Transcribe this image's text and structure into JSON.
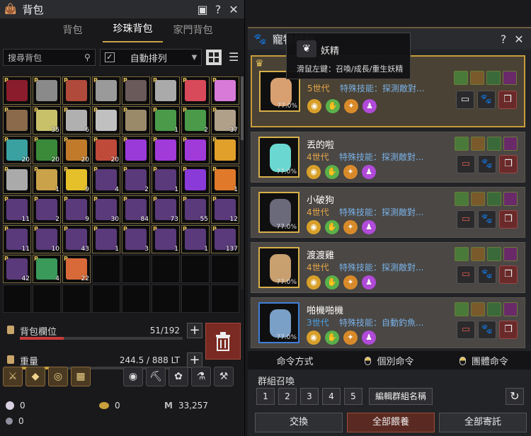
{
  "bag": {
    "title": "背包",
    "tabs": [
      "背包",
      "珍珠背包",
      "家門背包"
    ],
    "search_placeholder": "搜尋背包",
    "autosort_label": "自動排列",
    "autosort_checked": "✓",
    "slots_label": "背包欄位",
    "slots_value": "51/192",
    "slots_fill": 0.27,
    "weight_label": "重量",
    "weight_value": "244.5 / 888 LT",
    "weight_fill": 0.28,
    "items": [
      {
        "color": "#8a1c2c",
        "count": "",
        "p": "P"
      },
      {
        "color": "#8a8a8a",
        "count": "",
        "p": "P"
      },
      {
        "color": "#b04a3a",
        "count": "",
        "p": "P"
      },
      {
        "color": "#9a9a9a",
        "count": "",
        "p": "P"
      },
      {
        "color": "#6a5a5a",
        "count": "",
        "p": "P"
      },
      {
        "color": "#aaaaaa",
        "count": "",
        "p": "P"
      },
      {
        "color": "#d84a5a",
        "count": "",
        "p": "P"
      },
      {
        "color": "#d87ad8",
        "count": "",
        "p": "P"
      },
      {
        "color": "#8a6a4a",
        "count": "",
        "p": "P"
      },
      {
        "color": "#c9c06a",
        "count": "35",
        "p": "P"
      },
      {
        "color": "#b0b0b0",
        "count": "6",
        "p": "P"
      },
      {
        "color": "#c0c0c0",
        "count": "",
        "p": "P"
      },
      {
        "color": "#9a8a6a",
        "count": "",
        "p": "P"
      },
      {
        "color": "#4a9a4a",
        "count": "1",
        "p": "P"
      },
      {
        "color": "#4a9a4a",
        "count": "2",
        "p": "P"
      },
      {
        "color": "#b0a08a",
        "count": "37",
        "p": "P"
      },
      {
        "color": "#3aa0a0",
        "count": "20",
        "p": "P"
      },
      {
        "color": "#3a8a3a",
        "count": "20",
        "p": "P"
      },
      {
        "color": "#c07a2a",
        "count": "20",
        "p": "P"
      },
      {
        "color": "#c04a3a",
        "count": "20",
        "p": "P"
      },
      {
        "color": "#9a3ad8",
        "count": "",
        "p": "P"
      },
      {
        "color": "#a03ad8",
        "count": "",
        "p": "P"
      },
      {
        "color": "#a03ad8",
        "count": "",
        "p": "P"
      },
      {
        "color": "#e0a02a",
        "count": "",
        "p": "P"
      },
      {
        "color": "#aaaaaa",
        "count": "",
        "p": "P"
      },
      {
        "color": "#c9a24a",
        "count": "1",
        "p": "P"
      },
      {
        "color": "#e6c02a",
        "count": "9",
        "p": "P"
      },
      {
        "color": "#5a3a7a",
        "count": "4",
        "p": "P"
      },
      {
        "color": "#5a3a7a",
        "count": "2",
        "p": "P"
      },
      {
        "color": "#5a3a7a",
        "count": "1",
        "p": "P"
      },
      {
        "color": "#8a3ad8",
        "count": "",
        "p": "P"
      },
      {
        "color": "#e07a2a",
        "count": "1",
        "p": "P"
      },
      {
        "color": "#5a3a7a",
        "count": "11",
        "p": "P"
      },
      {
        "color": "#5a3a7a",
        "count": "2",
        "p": "P"
      },
      {
        "color": "#5a3a7a",
        "count": "9",
        "p": "P"
      },
      {
        "color": "#5a3a7a",
        "count": "30",
        "p": "P"
      },
      {
        "color": "#5a3a7a",
        "count": "84",
        "p": "P"
      },
      {
        "color": "#5a3a7a",
        "count": "73",
        "p": "P"
      },
      {
        "color": "#5a3a7a",
        "count": "55",
        "p": "P"
      },
      {
        "color": "#5a3a7a",
        "count": "12",
        "p": "P"
      },
      {
        "color": "#5a3a7a",
        "count": "11",
        "p": "P"
      },
      {
        "color": "#5a3a7a",
        "count": "10",
        "p": "P"
      },
      {
        "color": "#5a3a7a",
        "count": "43",
        "p": "P"
      },
      {
        "color": "#5a3a7a",
        "count": "1",
        "p": "P"
      },
      {
        "color": "#5a3a7a",
        "count": "3",
        "p": "P"
      },
      {
        "color": "#5a3a7a",
        "count": "1",
        "p": "P"
      },
      {
        "color": "#5a3a7a",
        "count": "1",
        "p": "P"
      },
      {
        "color": "#5a3a7a",
        "count": "137",
        "p": "P"
      },
      {
        "color": "#5a3a7a",
        "count": "42",
        "p": "P"
      },
      {
        "color": "#3a9a5a",
        "count": "4",
        "p": "P"
      },
      {
        "color": "#d86a3a",
        "count": "22",
        "p": "P"
      },
      null,
      null,
      null,
      null,
      null,
      null,
      null,
      null,
      null,
      null,
      null,
      null,
      null
    ],
    "tools": [
      {
        "name": "sword-icon",
        "glyph": "⚔",
        "gold": true
      },
      {
        "name": "gem-icon",
        "glyph": "◆",
        "gold": true
      },
      {
        "name": "ring-icon",
        "glyph": "◎",
        "gold": true
      },
      {
        "name": "grid-icon",
        "glyph": "▦",
        "gold": true
      },
      {
        "name": "lantern-icon",
        "glyph": "◉",
        "gold": false
      },
      {
        "name": "axe-icon",
        "glyph": "⛏",
        "gold": false
      },
      {
        "name": "triskele-icon",
        "glyph": "✿",
        "gold": false
      },
      {
        "name": "potion-icon",
        "glyph": "⚗",
        "gold": false
      },
      {
        "name": "hammer-icon",
        "glyph": "⚒",
        "gold": false
      }
    ],
    "currency": {
      "pearl": "0",
      "silver": "0",
      "coin": "0",
      "mileage": "33,257"
    }
  },
  "pets": {
    "title": "寵物目錄",
    "tooltip": {
      "name": "妖精",
      "hint": "滑鼠左鍵：召喚/成長/重生妖精"
    },
    "list": [
      {
        "name": "",
        "gen": "5世代",
        "skill": "特殊技能：探測敵對...",
        "pct": "77.0%",
        "body": "#d8a070",
        "sel": true,
        "blue": false
      },
      {
        "name": "丟的啦",
        "gen": "4世代",
        "skill": "特殊技能：探測敵對...",
        "pct": "77.0%",
        "body": "#6ad8d0",
        "sel": false,
        "blue": false
      },
      {
        "name": "小破狗",
        "gen": "4世代",
        "skill": "特殊技能：探測敵對...",
        "pct": "77.0%",
        "body": "#6a6a7a",
        "sel": false,
        "blue": false
      },
      {
        "name": "渡渡雞",
        "gen": "4世代",
        "skill": "特殊技能：探測敵對...",
        "pct": "77.0%",
        "body": "#c8a070",
        "sel": false,
        "blue": false
      },
      {
        "name": "啪機啪機",
        "gen": "3世代",
        "skill": "特殊技能：自動釣魚...",
        "pct": "77.0%",
        "body": "#7aa0c8",
        "sel": false,
        "blue": true
      }
    ],
    "cmd_label": "命令方式",
    "cmd_single": "個別命令",
    "cmd_group": "團體命令",
    "group_label": "群組召喚",
    "groups": [
      "1",
      "2",
      "3",
      "4",
      "5"
    ],
    "edit_group": "編輯群組名稱",
    "btn_swap": "交換",
    "btn_feed": "全部餵養",
    "btn_store": "全部寄託"
  }
}
